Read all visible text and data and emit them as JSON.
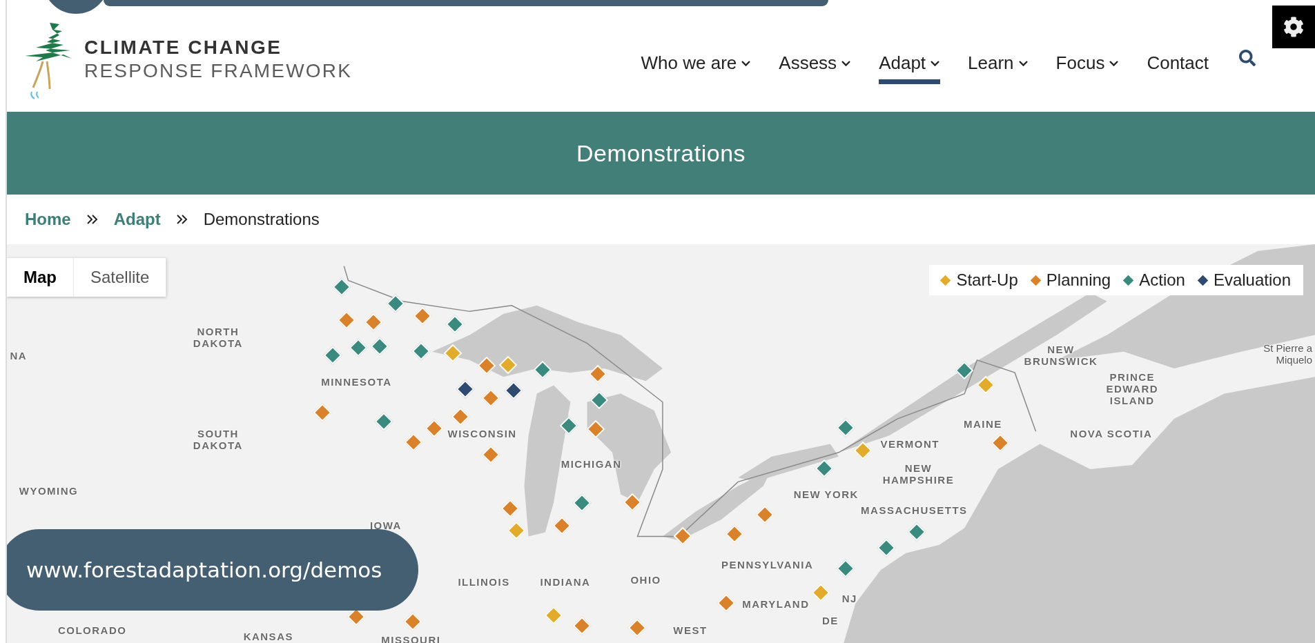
{
  "header": {
    "logo": {
      "line_1": "CLIMATE CHANGE",
      "line_2": "RESPONSE FRAMEWORK"
    },
    "nav": [
      {
        "label": "Who we are",
        "dropdown": true,
        "selected": false
      },
      {
        "label": "Assess",
        "dropdown": true,
        "selected": false
      },
      {
        "label": "Adapt",
        "dropdown": true,
        "selected": true
      },
      {
        "label": "Learn",
        "dropdown": true,
        "selected": false
      },
      {
        "label": "Focus",
        "dropdown": true,
        "selected": false
      },
      {
        "label": "Contact",
        "dropdown": false,
        "selected": false
      }
    ]
  },
  "banner": {
    "title": "Demonstrations"
  },
  "breadcrumb": [
    {
      "label": "Home",
      "kind": "link"
    },
    {
      "label": "Adapt",
      "kind": "link"
    },
    {
      "label": "Demonstrations",
      "kind": "current"
    }
  ],
  "map": {
    "view_toggle": [
      {
        "label": "Map",
        "selected": true
      },
      {
        "label": "Satellite",
        "selected": false
      }
    ],
    "legend": [
      {
        "label": "Start-Up",
        "color": "#e2ab2b"
      },
      {
        "label": "Planning",
        "color": "#d9822b"
      },
      {
        "label": "Action",
        "color": "#3b8a7f"
      },
      {
        "label": "Evaluation",
        "color": "#2e4a6e"
      }
    ],
    "labels": [
      "NA",
      "NORTH DAKOTA",
      "SOUTH DAKOTA",
      "WYOMING",
      "MINNESOTA",
      "IOWA",
      "ILLINOIS",
      "INDIANA",
      "OHIO",
      "COLORADO",
      "KANSAS",
      "MISSOURI",
      "WISCONSIN",
      "MICHIGAN",
      "NEW YORK",
      "PENNSYLVANIA",
      "MARYLAND",
      "NJ",
      "DE",
      "WEST",
      "VERMONT",
      "NEW HAMPSHIRE",
      "MASSACHUSETTS",
      "MAINE",
      "NEW BRUNSWICK",
      "PRINCE EDWARD ISLAND",
      "NOVA SCOTIA",
      "St Pierre a",
      "Miquelo"
    ]
  },
  "overlay": {
    "url": "www.forestadaptation.org/demos"
  }
}
